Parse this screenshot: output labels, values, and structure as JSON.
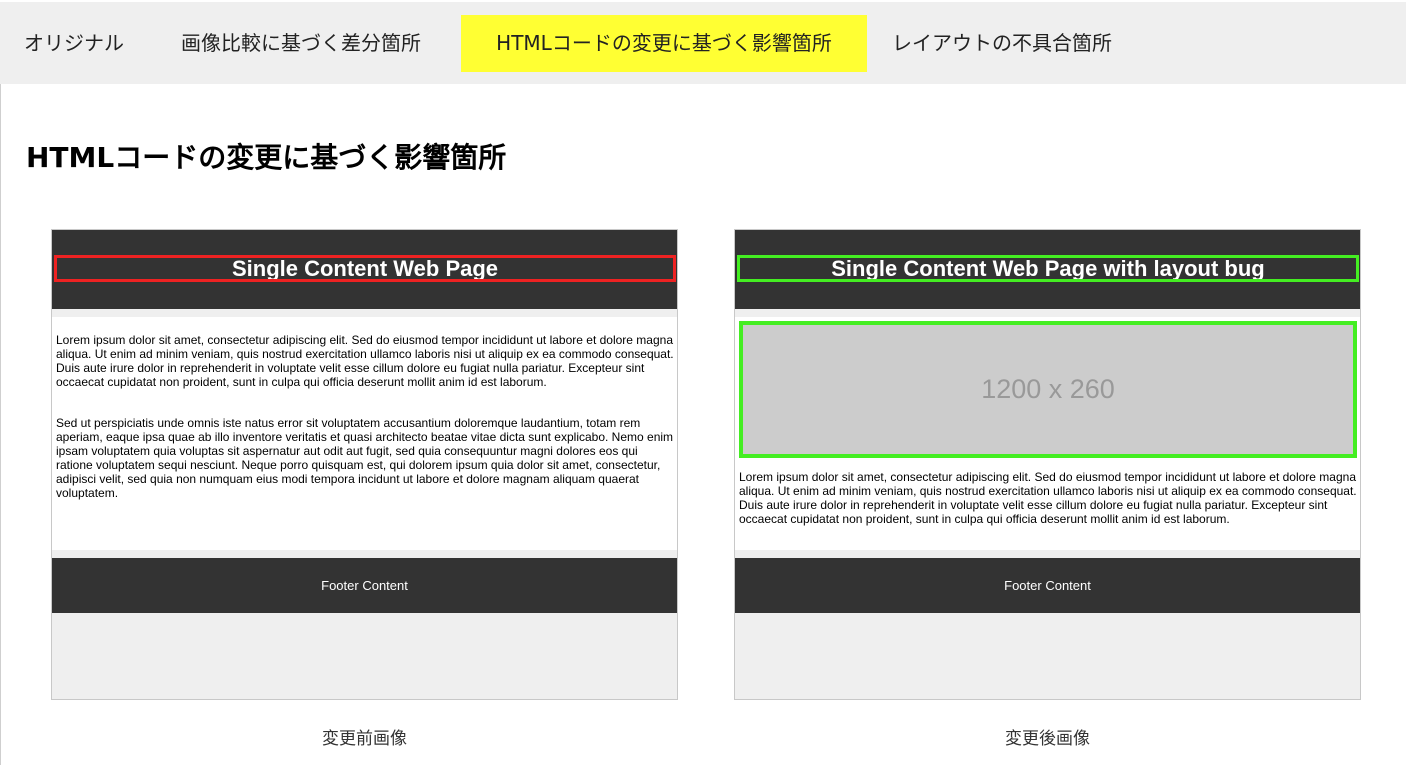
{
  "tabs": [
    {
      "label": "オリジナル"
    },
    {
      "label": "画像比較に基づく差分箇所"
    },
    {
      "label": "HTMLコードの変更に基づく影響箇所",
      "active": true
    },
    {
      "label": "レイアウトの不具合箇所"
    }
  ],
  "page_title": "HTMLコードの変更に基づく影響箇所",
  "before": {
    "header_title": "Single Content Web Page",
    "paragraphs": [
      "Lorem ipsum dolor sit amet, consectetur adipiscing elit. Sed do eiusmod tempor incididunt ut labore et dolore magna aliqua. Ut enim ad minim veniam, quis nostrud exercitation ullamco laboris nisi ut aliquip ex ea commodo consequat. Duis aute irure dolor in reprehenderit in voluptate velit esse cillum dolore eu fugiat nulla pariatur. Excepteur sint occaecat cupidatat non proident, sunt in culpa qui officia deserunt mollit anim id est laborum.",
      "Sed ut perspiciatis unde omnis iste natus error sit voluptatem accusantium doloremque laudantium, totam rem aperiam, eaque ipsa quae ab illo inventore veritatis et quasi architecto beatae vitae dicta sunt explicabo. Nemo enim ipsam voluptatem quia voluptas sit aspernatur aut odit aut fugit, sed quia consequuntur magni dolores eos qui ratione voluptatem sequi nesciunt. Neque porro quisquam est, qui dolorem ipsum quia dolor sit amet, consectetur, adipisci velit, sed quia non numquam eius modi tempora incidunt ut labore et dolore magnam aliquam quaerat voluptatem."
    ],
    "footer": "Footer Content",
    "caption": "変更前画像",
    "highlight_color": "#ee2222"
  },
  "after": {
    "header_title": "Single Content Web Page with layout bug",
    "placeholder_label": "1200 x 260",
    "paragraphs": [
      "Lorem ipsum dolor sit amet, consectetur adipiscing elit. Sed do eiusmod tempor incididunt ut labore et dolore magna aliqua. Ut enim ad minim veniam, quis nostrud exercitation ullamco laboris nisi ut aliquip ex ea commodo consequat. Duis aute irure dolor in reprehenderit in voluptate velit esse cillum dolore eu fugiat nulla pariatur. Excepteur sint occaecat cupidatat non proident, sunt in culpa qui officia deserunt mollit anim id est laborum."
    ],
    "footer": "Footer Content",
    "caption": "変更後画像",
    "highlight_color": "#44ee22"
  },
  "colors": {
    "active_tab": "#ffff33",
    "tab_bar": "#efefef",
    "dark_band": "#333333"
  }
}
